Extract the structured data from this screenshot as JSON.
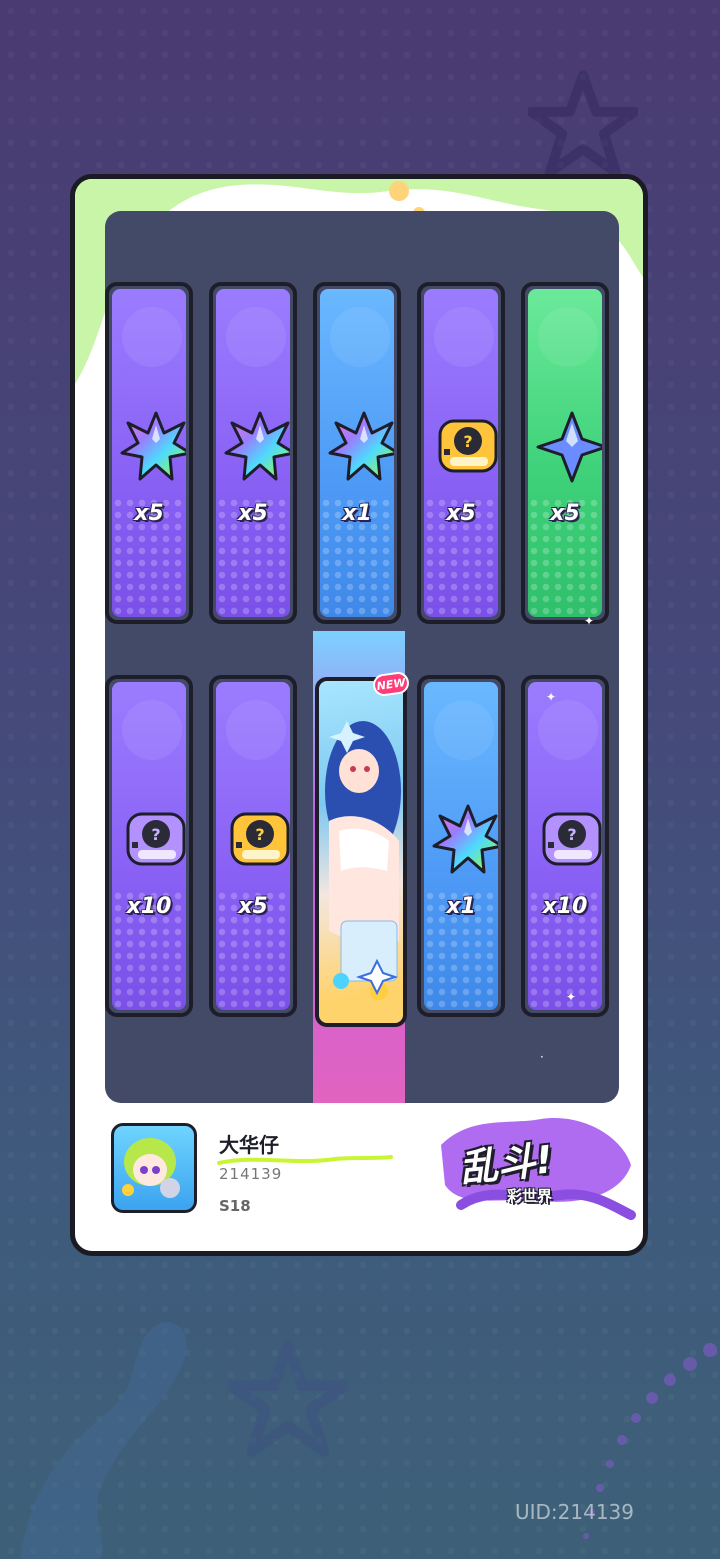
{
  "row1": [
    {
      "color": "purple",
      "icon": "rainbow-star-icon",
      "qty": "x5"
    },
    {
      "color": "purple",
      "icon": "rainbow-star-icon",
      "qty": "x5"
    },
    {
      "color": "blue",
      "icon": "rainbow-star-icon",
      "qty": "x1"
    },
    {
      "color": "purple",
      "icon": "gold-mystery-ticket-icon",
      "qty": "x5"
    },
    {
      "color": "green",
      "icon": "blue-crystal-star-icon",
      "qty": "x5"
    }
  ],
  "row2": [
    {
      "color": "purple",
      "icon": "purple-mystery-ticket-icon",
      "qty": "x10"
    },
    {
      "color": "purple",
      "icon": "gold-mystery-ticket-icon",
      "qty": "x5"
    },
    {
      "color": "blue",
      "icon": "rainbow-star-icon",
      "qty": "x1"
    },
    {
      "color": "purple",
      "icon": "purple-mystery-ticket-icon",
      "qty": "x10"
    }
  ],
  "featured": {
    "badge": "NEW"
  },
  "player": {
    "name": "大华仔",
    "id": "214139",
    "season": "S18"
  },
  "logo": {
    "main": "乱斗!",
    "sub": "彩世界"
  },
  "footer_uid": "UID:214139",
  "colors": {
    "purple": "#8a62f5",
    "blue": "#4f9cf7",
    "green": "#3fd27a",
    "dark": "#1e1e2b"
  }
}
